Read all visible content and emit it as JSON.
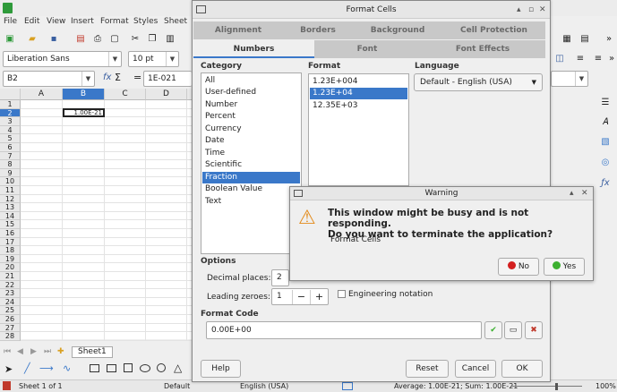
{
  "menubar": {
    "items": [
      "File",
      "Edit",
      "View",
      "Insert",
      "Format",
      "Styles",
      "Sheet"
    ]
  },
  "fontbar": {
    "font_name": "Liberation Sans",
    "font_size": "10 pt"
  },
  "formulabar": {
    "cell_ref": "B2",
    "fx": "fx",
    "sigma": "Σ",
    "equals": "=",
    "content": "1E-021"
  },
  "sheet": {
    "columns": [
      "A",
      "B",
      "C",
      "D"
    ],
    "rows": [
      "1",
      "2",
      "3",
      "4",
      "5",
      "6",
      "7",
      "8",
      "9",
      "10",
      "11",
      "12",
      "13",
      "14",
      "15",
      "16",
      "17",
      "18",
      "19",
      "20",
      "21",
      "22",
      "23",
      "24",
      "25",
      "26",
      "27",
      "28"
    ],
    "active_col": "B",
    "active_row": "2",
    "cell_value": "1.00E-21"
  },
  "sheettabs": {
    "tab": "Sheet1"
  },
  "status": {
    "sheet_of": "Sheet 1 of 1",
    "style": "Default",
    "language": "English (USA)",
    "sum": "Average: 1.00E-21; Sum: 1.00E-21",
    "zoom": "100%"
  },
  "format_cells": {
    "title": "Format Cells",
    "tabs_row1": [
      "Alignment",
      "Borders",
      "Background",
      "Cell Protection"
    ],
    "tabs_row2": [
      "Numbers",
      "Font",
      "Font Effects"
    ],
    "category_label": "Category",
    "categories": [
      "All",
      "User-defined",
      "Number",
      "Percent",
      "Currency",
      "Date",
      "Time",
      "Scientific",
      "Fraction",
      "Boolean Value",
      "Text"
    ],
    "selected_category": "Fraction",
    "format_label": "Format",
    "formats": [
      "1.23E+004",
      "1.23E+04",
      "12.35E+03"
    ],
    "selected_format": "1.23E+04",
    "language_label": "Language",
    "language_value": "Default - English (USA)",
    "options_label": "Options",
    "decimal_places_label": "Decimal places:",
    "decimal_places": "2",
    "leading_zeroes_label": "Leading zeroes:",
    "leading_zeroes": "1",
    "engineering_label": "Engineering notation",
    "format_code_label": "Format Code",
    "format_code": "0.00E+00",
    "help": "Help",
    "reset": "Reset",
    "cancel": "Cancel",
    "ok": "OK"
  },
  "warning": {
    "title": "Warning",
    "message_line1": "This window might be busy and is not responding.",
    "message_line2": "Do you want to terminate the application?",
    "subject": "Format Cells",
    "no": "No",
    "yes": "Yes"
  },
  "colors": {
    "accent": "#3a78c9",
    "warning_icon": "#e38b1b",
    "no_icon": "#d32020",
    "yes_icon": "#3cb030"
  }
}
